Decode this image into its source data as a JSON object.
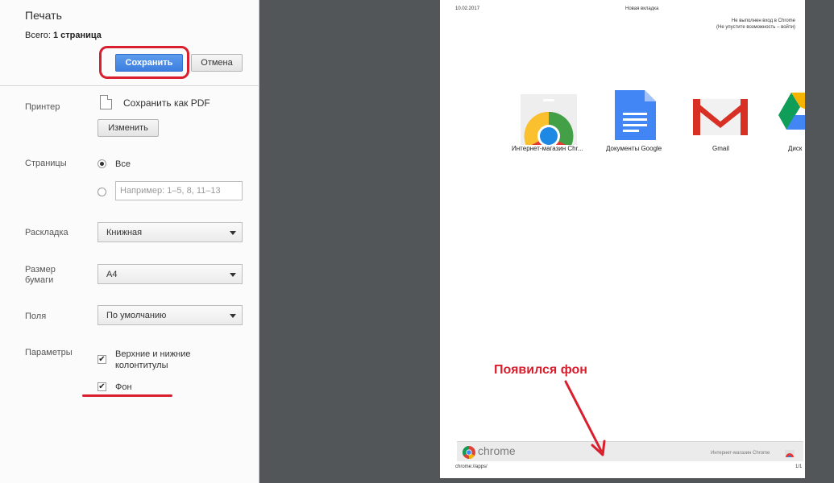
{
  "sidebar": {
    "title": "Печать",
    "total_prefix": "Всего:",
    "total_value": "1 страница",
    "save_label": "Сохранить",
    "cancel_label": "Отмена",
    "printer_label": "Принтер",
    "printer_value": "Сохранить как PDF",
    "change_label": "Изменить",
    "pages_label": "Страницы",
    "pages_all": "Все",
    "pages_placeholder": "Например: 1–5, 8, 11–13",
    "layout_label": "Раскладка",
    "layout_value": "Книжная",
    "paper_label": "Размер бумаги",
    "paper_value": "А4",
    "margins_label": "Поля",
    "margins_value": "По умолчанию",
    "options_label": "Параметры",
    "option_headers": "Верхние и нижние колонтитулы",
    "option_background": "Фон"
  },
  "preview": {
    "date": "10.02.2017",
    "page_title": "Новая вкладка",
    "signin_line1": "Не выполнен вход в Chrome",
    "signin_line2": "(Не упустите возможность – войти)",
    "tiles": [
      {
        "label": "Интернет-магазин Chr...",
        "icon": "chrome-webstore-icon"
      },
      {
        "label": "Документы Google",
        "icon": "google-docs-icon"
      },
      {
        "label": "Gmail",
        "icon": "gmail-icon"
      },
      {
        "label": "Диск",
        "icon": "google-drive-icon"
      }
    ],
    "footer_brand": "chrome",
    "footer_store": "Интернет-магазин Chrome",
    "footer_url": "chrome://apps/",
    "page_number": "1/1"
  },
  "annotation": {
    "text": "Появился фон"
  },
  "colors": {
    "accent": "#3d7fe0",
    "annotation_red": "#d91e2e",
    "preview_bg": "#525659"
  }
}
